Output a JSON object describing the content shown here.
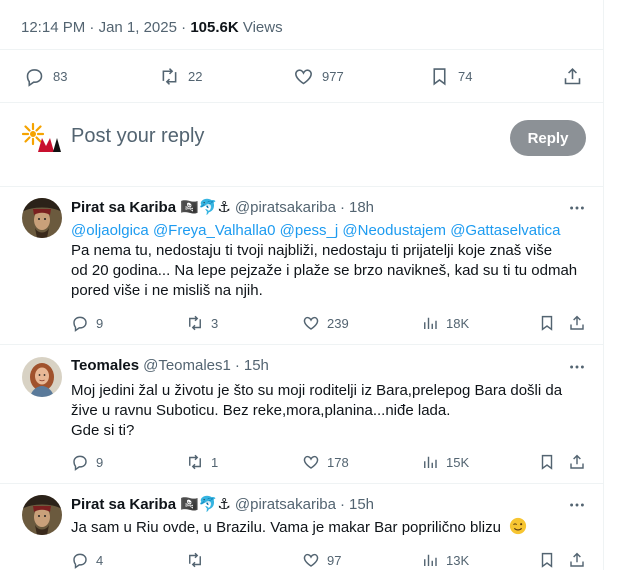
{
  "tweet_meta": {
    "time": "12:14 PM",
    "sep": "·",
    "date": "Jan 1, 2025",
    "views_count": "105.6K",
    "views_label": "Views"
  },
  "stats": {
    "replies": "83",
    "reposts": "22",
    "likes": "977",
    "bookmarks": "74"
  },
  "reply_box": {
    "placeholder": "Post your reply",
    "button": "Reply"
  },
  "posts": [
    {
      "name": "Pirat sa Kariba",
      "emojis": "🏴‍☠️🐬⚓",
      "handle": "@piratsakariba",
      "dot": "·",
      "time": "18h",
      "mentions": [
        "@oljaolgica",
        "@Freya_Valhalla0",
        "@pess_j",
        "@Neodustajem",
        "@Gattaselvatica"
      ],
      "text_lines": [
        "Pa nema tu, nedostaju ti tvoji najbliži, nedostaju ti prijatelji koje znaš više",
        "od 20 godina... Na lepe pejzaže i plaže se brzo navikneš, kad su ti tu odmah",
        "pored više i ne misliš na njih."
      ],
      "replies": "9",
      "reposts": "3",
      "likes": "239",
      "views": "18K"
    },
    {
      "name": "Teomales",
      "handle": "@Teomales1",
      "dot": "·",
      "time": "15h",
      "text_lines": [
        "Moj jedini žal u životu je što su moji roditelji iz Bara,prelepog Bara došli da",
        "žive u ravnu Suboticu. Bez reke,mora,planina...niđe lada.",
        "Gde si ti?"
      ],
      "replies": "9",
      "reposts": "1",
      "likes": "178",
      "views": "15K"
    },
    {
      "name": "Pirat sa Kariba",
      "emojis": "🏴‍☠️🐬⚓",
      "handle": "@piratsakariba",
      "dot": "·",
      "time": "15h",
      "text_lines": [
        "Ja sam u Riu ovde, u Brazilu. Vama je makar Bar poprilično blizu"
      ],
      "replies": "4",
      "reposts": "",
      "likes": "97",
      "views": "13K"
    }
  ],
  "colors": {
    "accent": "#1d9bf0",
    "muted": "#536471",
    "reply_button": "#8c9196"
  }
}
